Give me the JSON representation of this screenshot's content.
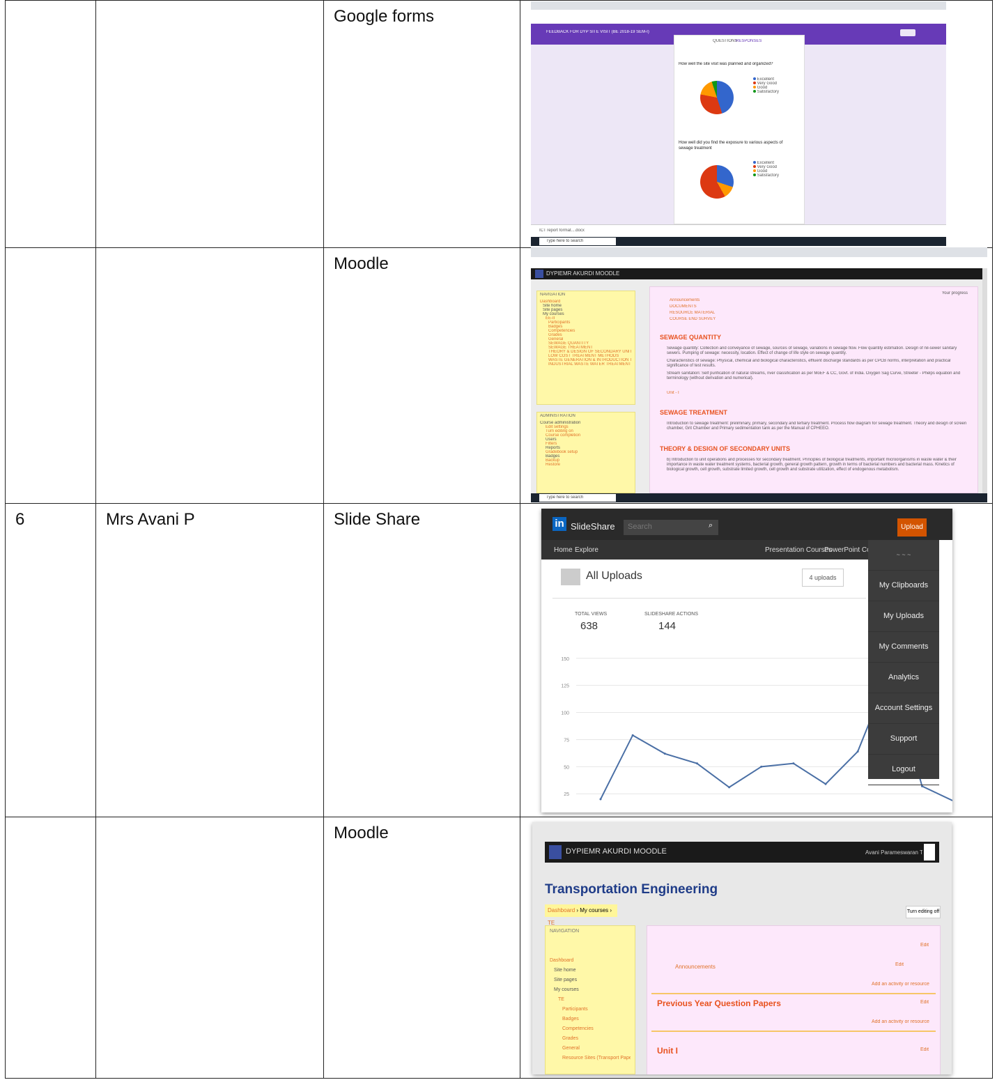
{
  "table": {
    "rows": [
      {
        "sr": "",
        "name": "",
        "tool": "Google forms"
      },
      {
        "sr": "",
        "name": "",
        "tool": "Moodle"
      },
      {
        "sr": "6",
        "name": "Mrs Avani P",
        "tool": "Slide Share"
      },
      {
        "sr": "",
        "name": "",
        "tool": "Moodle"
      }
    ]
  },
  "gforms": {
    "header_title": "FEEDBACK FOR DYP SITE VISIT (BE 2018-19 SEM-I)",
    "tabs": [
      "QUESTIONS",
      "RESPONSES"
    ],
    "q1": "How well the site visit was planned and organized?",
    "q2": "How well did you find the exposure to various aspects of sewage treatment",
    "legend": [
      "Excellent",
      "Very Good",
      "Good",
      "Satisfactory"
    ],
    "colors": {
      "excellent": "#3366cc",
      "very_good": "#dc3912",
      "good": "#ff9900",
      "satisfactory": "#109618"
    },
    "download_item": "ICT report format....docx",
    "taskbar_search": "Type here to search"
  },
  "moodle1": {
    "site": "DYPIEMR AKURDI MOODLE",
    "nav_title": "NAVIGATION",
    "nav_items": [
      "Dashboard",
      "Site home",
      "Site pages",
      "My courses",
      "EE-II",
      "Participants",
      "Badges",
      "Competencies",
      "Grades",
      "General",
      "SEWAGE QUANTITY",
      "SEWAGE TREATMENT",
      "THEORY & DESIGN OF SECONDARY UNITS",
      "LOW COST TREATMENT METHODS",
      "WASTE GENERATION & INTRODUCTION TO PROMOTE QE",
      "INDUSTRIAL WASTE WATER TREATMENT"
    ],
    "admin_title": "ADMINISTRATION",
    "admin_items": [
      "Course administration",
      "Edit settings",
      "Turn editing on",
      "Course completion",
      "Users",
      "Filters",
      "Reports",
      "Gradebook setup",
      "Badges",
      "Backup",
      "Restore",
      "Import"
    ],
    "resources": [
      "Announcements",
      "DOCUMENTS",
      "RESOURCE MATERIAL",
      "COURSE END SURVEY"
    ],
    "progress_label": "Your progress",
    "section1": "SEWAGE QUANTITY",
    "section1_lines": [
      "Sewage quantity: Collection and conveyance of sewage, sources of sewage, variations in sewage flow. Flow quantity estimation. Design of nil-sewer sanitary sewers. Pumping of sewage: necessity, location. Effect of change of life style on sewage quantity.",
      "Characteristics of sewage: Physical, chemical and biological characteristics, effluent discharge standards as per CPCB norms, interpretation and practical significance of test results.",
      "Stream sanitation: Self purification of natural streams, river classification as per MoEF & CC, Govt. of India. Oxygen Sag Curve, Streeter - Phelps equation and terminology (without derivation and numerical)."
    ],
    "unit_link": "Unit - I",
    "section2": "SEWAGE TREATMENT",
    "section2_text": "Introduction to sewage treatment: preliminary, primary, secondary and tertiary treatment. Process flow diagram for sewage treatment. Theory and design of screen chamber, Grit Chamber and Primary sedimentation tank as per the Manual of CPHEEO.",
    "section3": "THEORY & DESIGN OF SECONDARY UNITS",
    "section3_text": "b) Introduction to unit operations and processes for secondary treatment. Principles of biological treatments, important microorganisms in waste water & their importance in waste water treatment systems, bacterial growth, general growth pattern, growth in terms of bacterial numbers and bacterial mass. Kinetics of biological growth, cell growth, substrate limited growth, cell growth and substrate utilization, effect of endogenous metabolism."
  },
  "slideshare": {
    "brand": "SlideShare",
    "search_placeholder": "Search",
    "upload_btn": "Upload",
    "nav": [
      "Home",
      "Explore"
    ],
    "nav_right": [
      "Presentation Courses",
      "PowerPoint Cours"
    ],
    "page_title": "All Uploads",
    "uploads_dropdown": "4 uploads",
    "stat1_label": "TOTAL VIEWS",
    "stat1_value": "638",
    "stat2_label": "SLIDESHARE ACTIONS",
    "stat2_value": "144",
    "menu": [
      "My Clipboards",
      "My Uploads",
      "My Comments",
      "Analytics",
      "Account Settings",
      "Support",
      "Logout"
    ],
    "line_color": "#4a6fa5"
  },
  "chart_data": {
    "type": "line",
    "yticks": [
      25,
      50,
      75,
      100,
      125,
      150
    ],
    "ylim": [
      20,
      155
    ],
    "values": [
      20,
      79,
      62,
      53,
      31,
      50,
      53,
      34,
      64,
      138,
      32,
      18
    ],
    "xlabel": "",
    "ylabel": ""
  },
  "moodle2": {
    "site": "DYPIEMR AKURDI MOODLE",
    "user": "Avani Parameswaran Thampi",
    "course_title": "Transportation Engineering",
    "breadcrumb": [
      "Dashboard",
      "My courses",
      "TE"
    ],
    "edit_btn": "Turn editing off",
    "nav_title": "NAVIGATION",
    "nav_items": [
      "Dashboard",
      "Site home",
      "Site pages",
      "My courses",
      "TE",
      "Participants",
      "Badges",
      "Competencies",
      "Grades",
      "General",
      "Resource Sites (Transport Papers)"
    ],
    "announcements": "Announcements",
    "edit_label": "Edit",
    "add_activity": "Add an activity or resource",
    "section1": "Previous Year Question Papers",
    "section2": "Unit I"
  }
}
